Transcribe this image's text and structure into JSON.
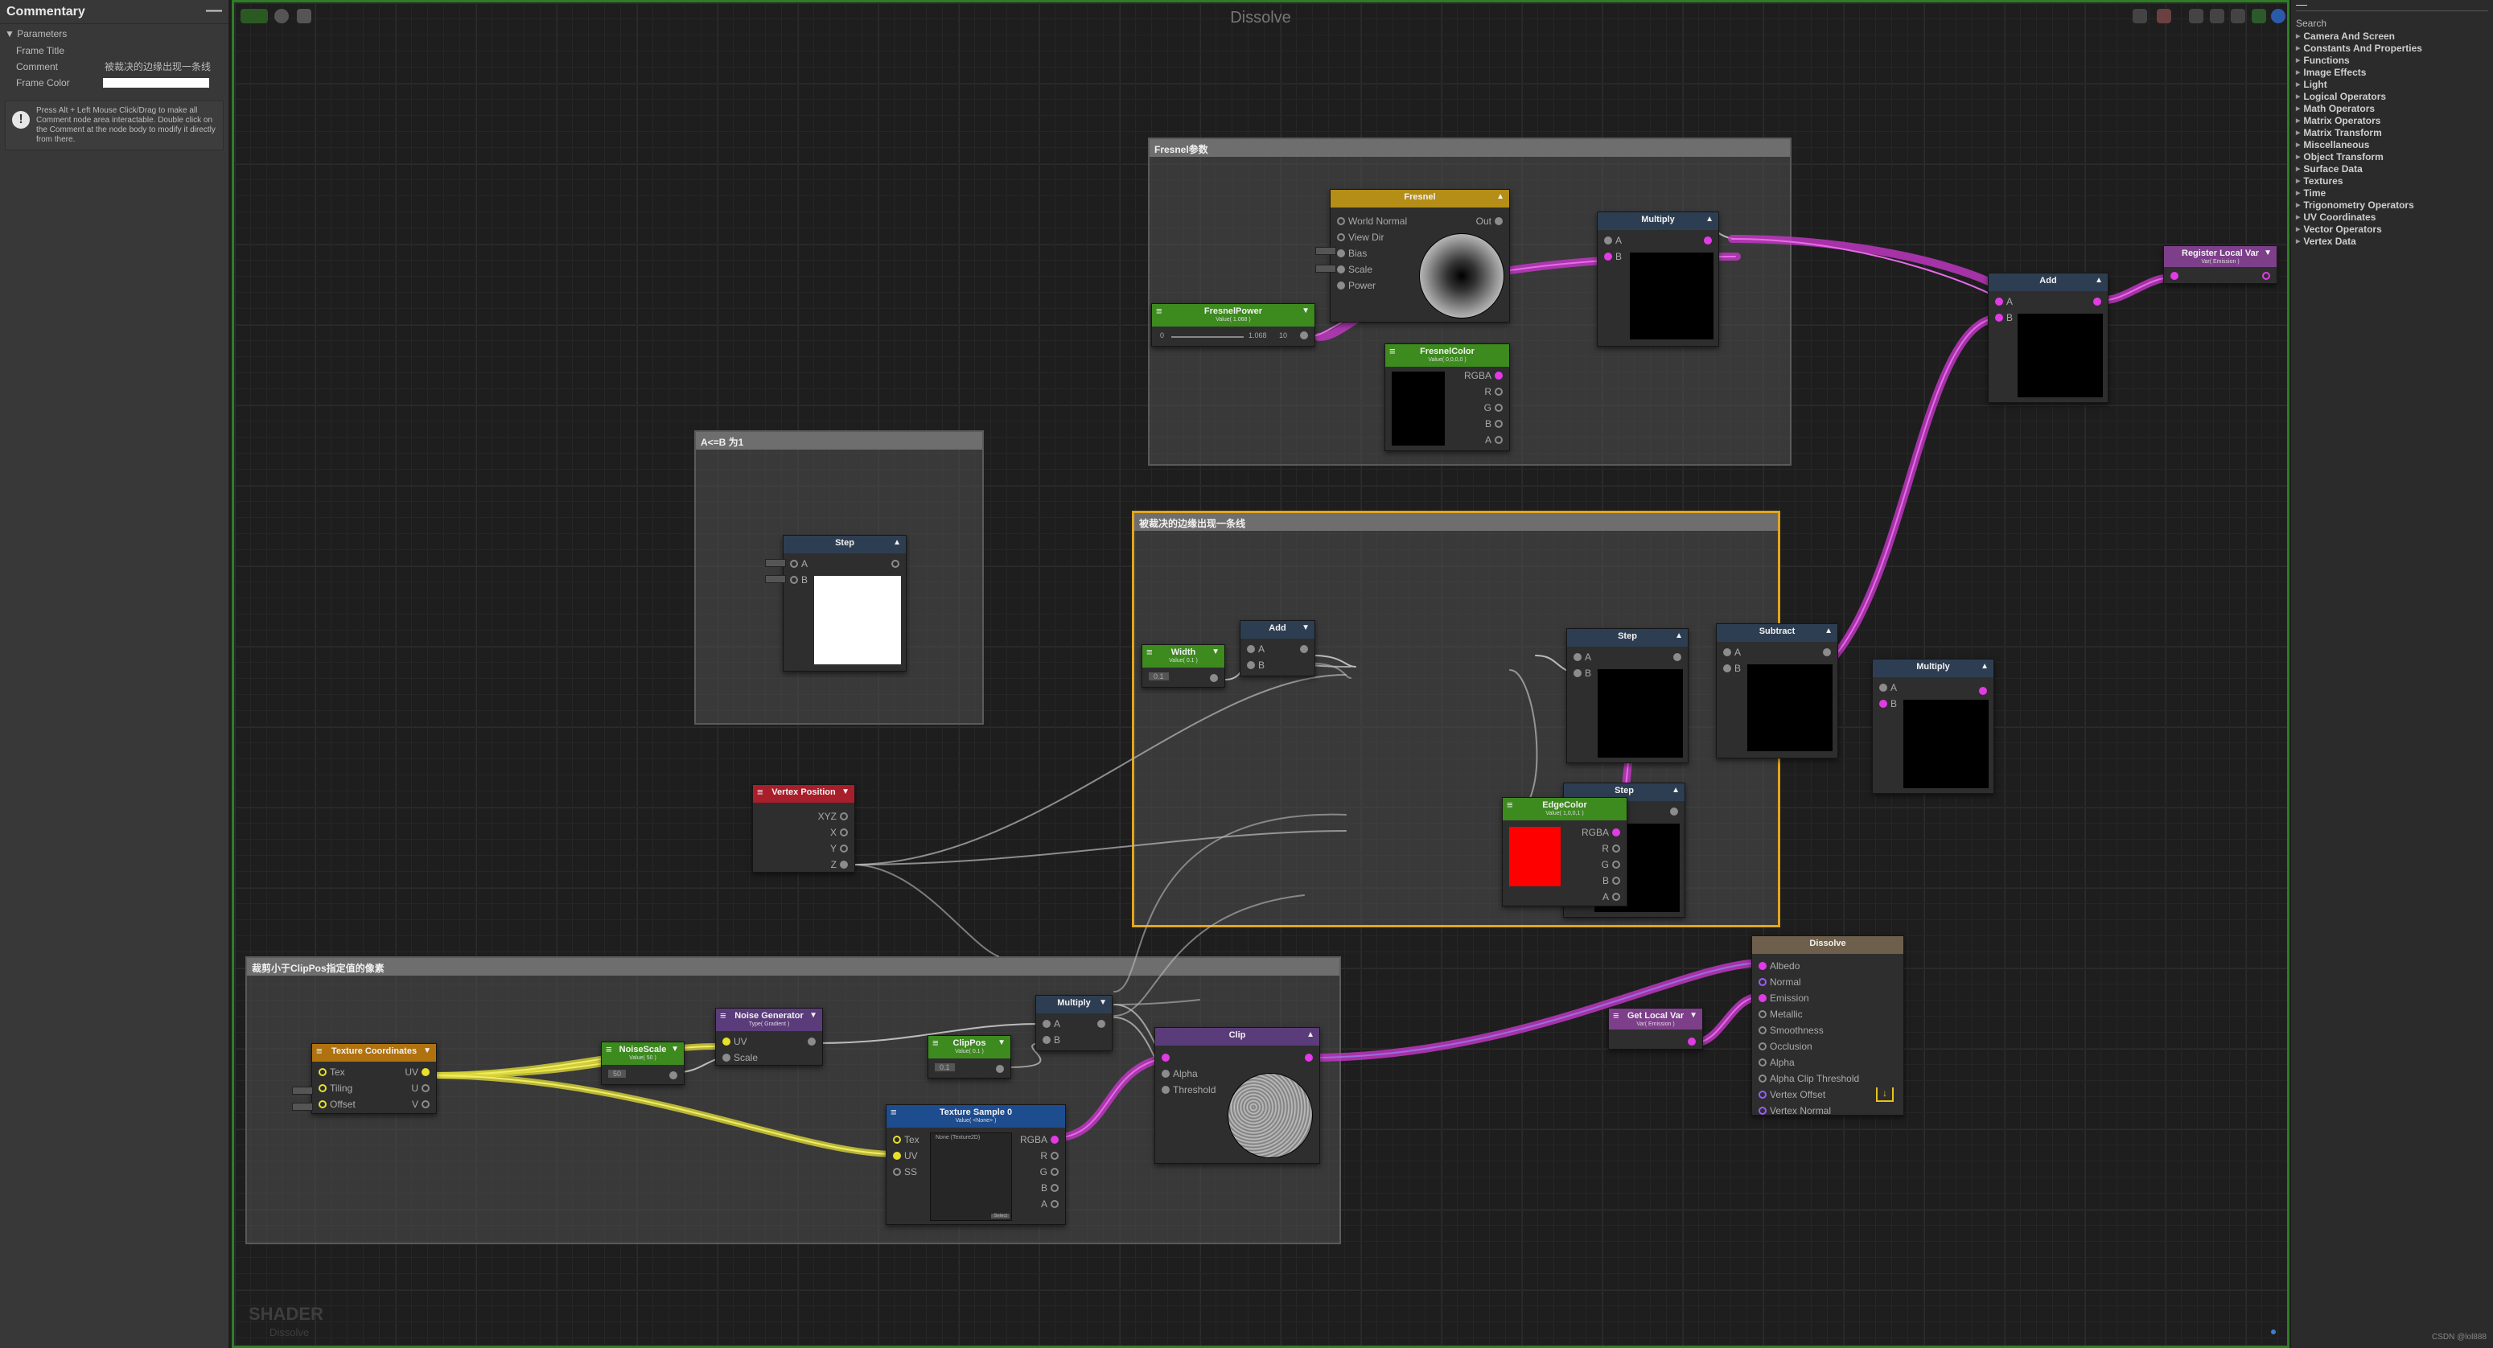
{
  "app": {
    "title": "Dissolve",
    "watermark": "SHADER",
    "watermark_sub": "Dissolve",
    "credit": "CSDN @lol888"
  },
  "left_panel": {
    "title": "Commentary",
    "minimize": "—",
    "section": "Parameters",
    "frame_title_label": "Frame Title",
    "comment_label": "Comment",
    "comment_value": "被裁决的边缘出现一条线",
    "frame_color_label": "Frame Color",
    "frame_color_value": "#ffffff",
    "note_icon": "!",
    "note": "Press Alt + Left Mouse Click/Drag to make all Comment node area interactable. Double click on the Comment at the node body to modify it directly from there."
  },
  "right_panel": {
    "minimize": "—",
    "search_label": "Search",
    "categories": [
      "Camera And Screen",
      "Constants And Properties",
      "Functions",
      "Image Effects",
      "Light",
      "Logical Operators",
      "Math Operators",
      "Matrix Operators",
      "Matrix Transform",
      "Miscellaneous",
      "Object Transform",
      "Surface Data",
      "Textures",
      "Time",
      "Trigonometry Operators",
      "UV Coordinates",
      "Vector Operators",
      "Vertex Data"
    ]
  },
  "frames": {
    "fresnel": "Fresnel参数",
    "step": "A<=B 为1",
    "edge": "被裁决的边缘出现一条线",
    "clip": "裁剪小于ClipPos指定值的像素"
  },
  "nodes": {
    "fresnel": {
      "title": "Fresnel",
      "pins": [
        "World Normal",
        "View Dir",
        "Bias",
        "Scale",
        "Power"
      ],
      "out": "Out"
    },
    "fresnel_power": {
      "title": "FresnelPower",
      "sub": "Value( 1.068 )",
      "v1": "0",
      "v2": "1.068",
      "v3": "10"
    },
    "fresnel_color": {
      "title": "FresnelColor",
      "sub": "Value( 0,0,0,0 )",
      "outs": [
        "RGBA",
        "R",
        "G",
        "B",
        "A"
      ]
    },
    "multiply1": {
      "title": "Multiply",
      "pins": [
        "A",
        "B"
      ]
    },
    "add_top": {
      "title": "Add",
      "pins": [
        "A",
        "B"
      ]
    },
    "register": {
      "title": "Register Local Var",
      "sub": "Var( Emission )"
    },
    "step_frame": {
      "title": "Step",
      "pins": [
        "A",
        "B"
      ]
    },
    "width": {
      "title": "Width",
      "sub": "Value( 0.1 )",
      "val": "0.1"
    },
    "add_mid": {
      "title": "Add",
      "pins": [
        "A",
        "B"
      ]
    },
    "step1": {
      "title": "Step",
      "pins": [
        "A",
        "B"
      ]
    },
    "step2": {
      "title": "Step",
      "pins": [
        "A",
        "B"
      ]
    },
    "subtract": {
      "title": "Subtract",
      "pins": [
        "A",
        "B"
      ]
    },
    "multiply2": {
      "title": "Multiply",
      "pins": [
        "A",
        "B"
      ]
    },
    "edge_color": {
      "title": "EdgeColor",
      "sub": "Value( 1,0,0,1 )",
      "outs": [
        "RGBA",
        "R",
        "G",
        "B",
        "A"
      ]
    },
    "vertex_pos": {
      "title": "Vertex Position",
      "outs": [
        "XYZ",
        "X",
        "Y",
        "Z"
      ]
    },
    "tex_coords": {
      "title": "Texture Coordinates",
      "pins": [
        "Tex",
        "Tiling",
        "Offset"
      ],
      "outs": [
        "UV",
        "U",
        "V"
      ]
    },
    "noise_scale": {
      "title": "NoiseScale",
      "sub": "Value( 50 )",
      "val": "50"
    },
    "noise_gen": {
      "title": "Noise Generator",
      "sub": "Type( Gradient )",
      "pins": [
        "UV",
        "Scale"
      ]
    },
    "clip_pos": {
      "title": "ClipPos",
      "sub": "Value( 0.1 )",
      "val": "0.1"
    },
    "multiply3": {
      "title": "Multiply",
      "pins": [
        "A",
        "B"
      ]
    },
    "tex_sample": {
      "title": "Texture Sample 0",
      "sub": "Value( <None> )",
      "pins": [
        "Tex",
        "UV",
        "SS"
      ],
      "outs": [
        "RGBA",
        "R",
        "G",
        "B",
        "A"
      ],
      "inner": "None (Texture2D)",
      "sel": "Select"
    },
    "clip": {
      "title": "Clip",
      "pins": [
        "Alpha",
        "Threshold"
      ]
    },
    "get_local": {
      "title": "Get Local Var",
      "sub": "Var( Emission )"
    },
    "dissolve": {
      "title": "Dissolve",
      "pins": [
        "Albedo",
        "Normal",
        "Emission",
        "Metallic",
        "Smoothness",
        "Occlusion",
        "Alpha",
        "Alpha Clip Threshold",
        "Vertex Offset",
        "Vertex Normal"
      ]
    }
  },
  "colors": {
    "frame_select": "#e3a51f",
    "wire_magenta": "#c737c9",
    "wire_yellow": "#d8d43a",
    "edge_color": "#ff0000"
  }
}
